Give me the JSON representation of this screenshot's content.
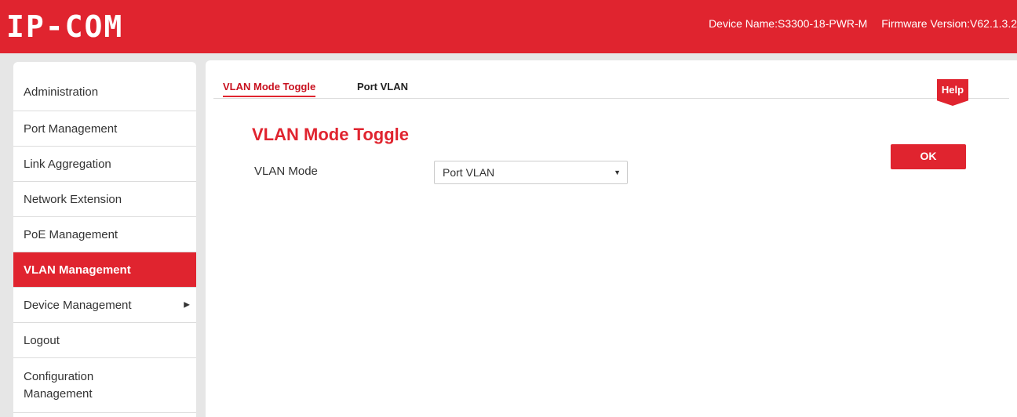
{
  "brand": {
    "logo_text": "IP-COM",
    "accent_color": "#e0242f"
  },
  "header": {
    "device_name": "Device Name:S3300-18-PWR-M",
    "firmware_version": "Firmware Version:V62.1.3.2"
  },
  "sidebar": {
    "items": [
      {
        "label": "Administration",
        "active": false
      },
      {
        "label": "Port Management",
        "active": false
      },
      {
        "label": "Link Aggregation",
        "active": false
      },
      {
        "label": "Network Extension",
        "active": false
      },
      {
        "label": "PoE Management",
        "active": false
      },
      {
        "label": "VLAN Management",
        "active": true
      },
      {
        "label": "Device Management",
        "active": false,
        "has_submenu": true,
        "submenu_icon": "triangle-right-icon"
      },
      {
        "label": "Logout",
        "active": false
      },
      {
        "label": "Configuration Management",
        "active": false
      }
    ]
  },
  "main": {
    "tabs": [
      {
        "label": "VLAN Mode Toggle",
        "active": true
      },
      {
        "label": "Port VLAN",
        "active": false
      }
    ],
    "help_label": "Help",
    "section_title": "VLAN Mode Toggle",
    "form": {
      "vlan_mode_label": "VLAN Mode",
      "vlan_mode_value": "Port VLAN",
      "vlan_mode_icon": "chevron-down-icon"
    },
    "ok_label": "OK"
  }
}
